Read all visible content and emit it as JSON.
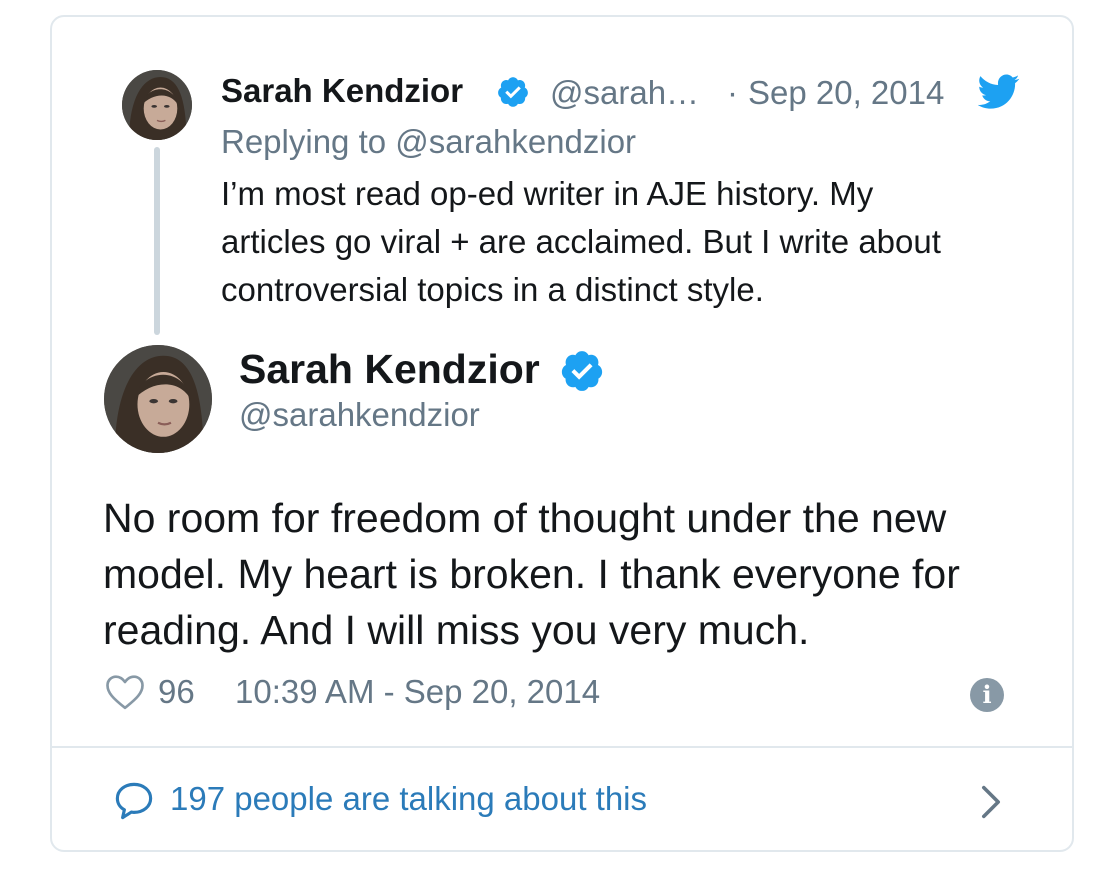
{
  "quoted_tweet": {
    "name": "Sarah Kendzior",
    "handle": "@sarah…",
    "separator": "·",
    "date": "Sep 20, 2014",
    "replying_to": "Replying to @sarahkendzior",
    "text_lines": [
      "I’m most read op-ed writer in AJE history. My",
      "articles go viral + are acclaimed. But I write about",
      "controversial topics in a distinct style."
    ]
  },
  "main_tweet": {
    "name": "Sarah Kendzior",
    "handle": "@sarahkendzior",
    "text_lines": [
      "No room for freedom of thought under the new",
      "model. My heart is broken. I thank everyone for",
      "reading. And I will miss you very much."
    ],
    "likes": "96",
    "timestamp": "10:39 AM - Sep 20, 2014"
  },
  "footer": {
    "talking_text": "197 people are talking about this"
  },
  "icons": {
    "verified": "verified-badge-icon",
    "bird": "twitter-bird-icon",
    "heart": "heart-icon",
    "info": "info-icon",
    "bubble": "speech-bubble-icon",
    "chevron": "chevron-right-icon"
  },
  "colors": {
    "twitter_blue": "#1da1f2",
    "link_blue": "#2b7bb9",
    "secondary_text": "#657786",
    "border": "#e1e8ed"
  }
}
